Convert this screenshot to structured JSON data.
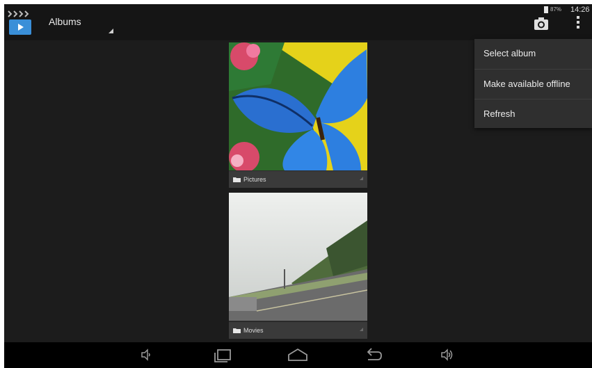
{
  "action_bar": {
    "title": "Albums",
    "app_icon": "play-app-icon",
    "camera_icon": "camera-icon",
    "overflow_icon": "overflow-menu-icon"
  },
  "status_bar": {
    "battery_icon": "battery-icon",
    "battery_percent": "87%",
    "time": "14:26"
  },
  "albums": [
    {
      "label": "Pictures",
      "icon": "folder-icon"
    },
    {
      "label": "Movies",
      "icon": "folder-icon"
    }
  ],
  "menu": {
    "items": [
      {
        "label": "Select album"
      },
      {
        "label": "Make available offline"
      },
      {
        "label": "Refresh"
      }
    ]
  },
  "nav_bar": {
    "icons": [
      "volume-down-icon",
      "recent-apps-icon",
      "home-icon",
      "back-icon",
      "volume-up-icon"
    ]
  },
  "colors": {
    "background": "#1c1c1c",
    "action_bar": "#151515",
    "menu": "#2f2f2f",
    "app_icon_accent": "#3a8fd8"
  }
}
